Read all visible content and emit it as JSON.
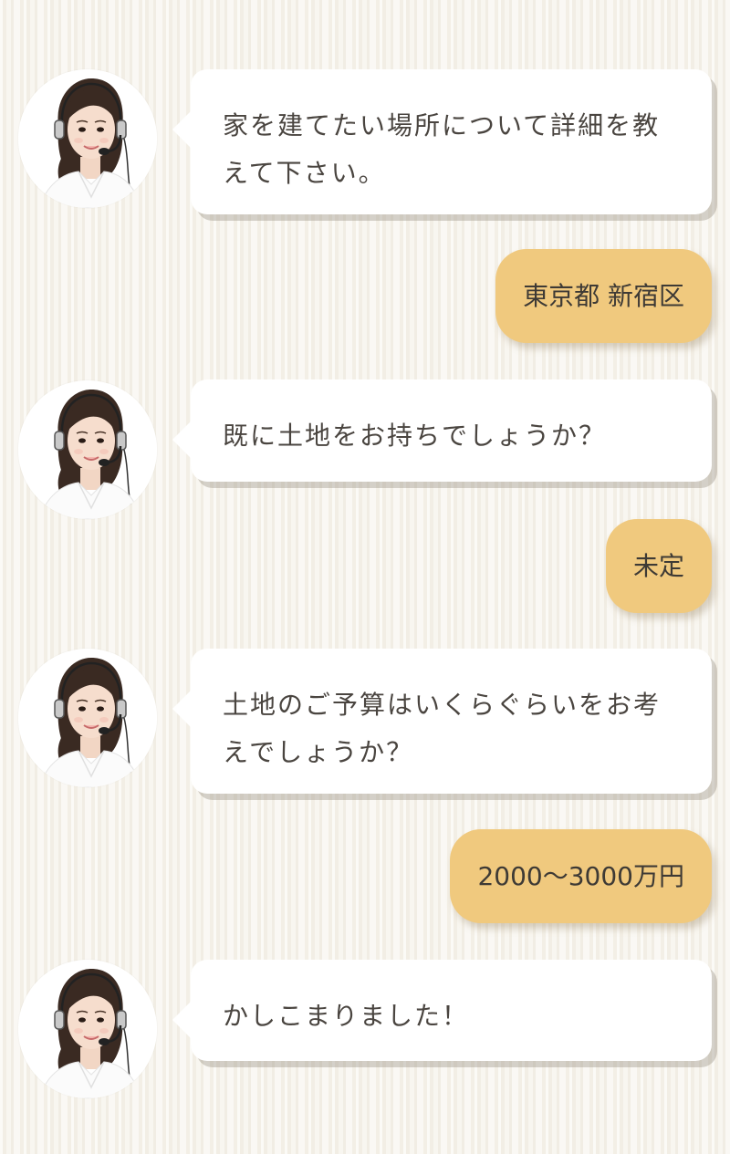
{
  "messages": [
    {
      "role": "operator",
      "text": "家を建てたい場所について詳細を教えて下さい。"
    },
    {
      "role": "user",
      "text": "東京都 新宿区"
    },
    {
      "role": "operator",
      "text": "既に土地をお持ちでしょうか？"
    },
    {
      "role": "user",
      "text": "未定"
    },
    {
      "role": "operator",
      "text": "土地のご予算はいくらぐらいをお考えでしょうか？"
    },
    {
      "role": "user",
      "text": "2000〜3000万円"
    },
    {
      "role": "operator",
      "text": "かしこまりました！"
    }
  ],
  "colors": {
    "user_bubble": "#f0c97e",
    "operator_bubble": "#ffffff",
    "text": "#4a4540"
  }
}
